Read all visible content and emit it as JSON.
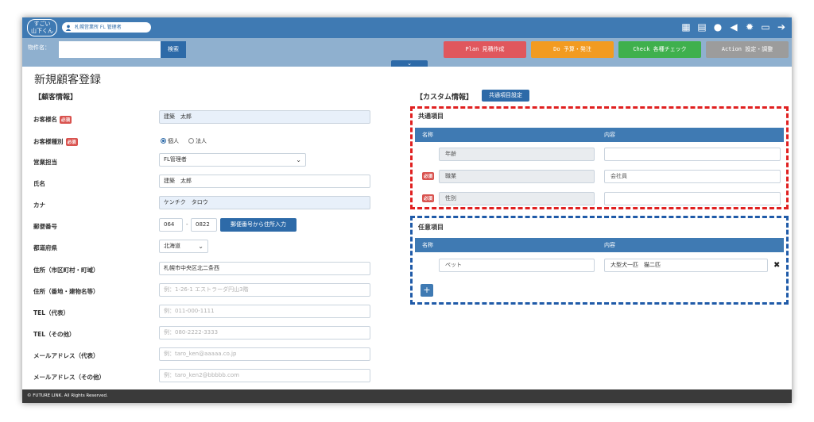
{
  "header": {
    "logo_text": "すごい\n山下くん",
    "user_pill": "札幌営業所 FL 管理者",
    "icons": [
      "building-icon",
      "calendar-icon",
      "chat-icon",
      "megaphone-icon",
      "gear-icon",
      "folder-icon",
      "logout-icon"
    ]
  },
  "search": {
    "label": "物件名：",
    "value": "",
    "button_label": "検索"
  },
  "pdca": {
    "plan": {
      "key": "Plan",
      "label": "見積作成",
      "color": "#e0575d"
    },
    "do": {
      "key": "Do",
      "label": "予算・発注",
      "color": "#f29b21"
    },
    "check": {
      "key": "Check",
      "label": "各種チェック",
      "color": "#3fb04d"
    },
    "action": {
      "key": "Action",
      "label": "設定・調整",
      "color": "#9c9c9c"
    },
    "collapse_icon": "chevron-down-icon"
  },
  "page": {
    "title": "新規顧客登録",
    "customer_section": "【顧客情報】",
    "required_badge": "必須"
  },
  "form": {
    "customer_name": {
      "label": "お客様名",
      "value": "建築　太郎"
    },
    "customer_type": {
      "label": "お客様種別",
      "options": [
        "個人",
        "法人"
      ],
      "selected": "個人"
    },
    "sales_rep": {
      "label": "営業担当",
      "value": "FL管理者"
    },
    "full_name": {
      "label": "氏名",
      "value": "建築　太郎"
    },
    "kana": {
      "label": "カナ",
      "value": "ケンチク　タロウ"
    },
    "postal": {
      "label": "郵便番号",
      "part1": "064",
      "separator": "-",
      "part2": "0822",
      "button_label": "郵便番号から住所入力"
    },
    "prefecture": {
      "label": "都道府県",
      "value": "北海道"
    },
    "address1": {
      "label": "住所（市区町村・町域）",
      "value": "札幌市中央区北二条西"
    },
    "address2": {
      "label": "住所（番地・建物名等）",
      "placeholder": "例：1-26-1 エストラーダ円山3階"
    },
    "tel_main": {
      "label": "TEL（代表）",
      "placeholder": "例：011-000-1111"
    },
    "tel_other": {
      "label": "TEL（その他）",
      "placeholder": "例：080-2222-3333"
    },
    "email_main": {
      "label": "メールアドレス（代表）",
      "placeholder": "例：taro_ken@aaaaa.co.jp"
    },
    "email_other": {
      "label": "メールアドレス（その他）",
      "placeholder": "例：taro_ken2@bbbbb.com"
    }
  },
  "custom": {
    "section_title": "【カスタム情報】",
    "settings_button": "共通項目設定",
    "common": {
      "title": "共通項目",
      "col_name": "名称",
      "col_content": "内容",
      "rows": [
        {
          "required": false,
          "name": "年齢",
          "content": ""
        },
        {
          "required": true,
          "name": "職業",
          "content": "会社員"
        },
        {
          "required": true,
          "name": "性別",
          "content": ""
        }
      ]
    },
    "optional": {
      "title": "任意項目",
      "col_name": "名称",
      "col_content": "内容",
      "rows": [
        {
          "name": "ペット",
          "content": "大型犬一匹　猫二匹"
        }
      ],
      "add_label": "+",
      "delete_label": "✖"
    }
  },
  "footer": {
    "copyright": "© FUTURE LINK. All Rights Reserved."
  }
}
